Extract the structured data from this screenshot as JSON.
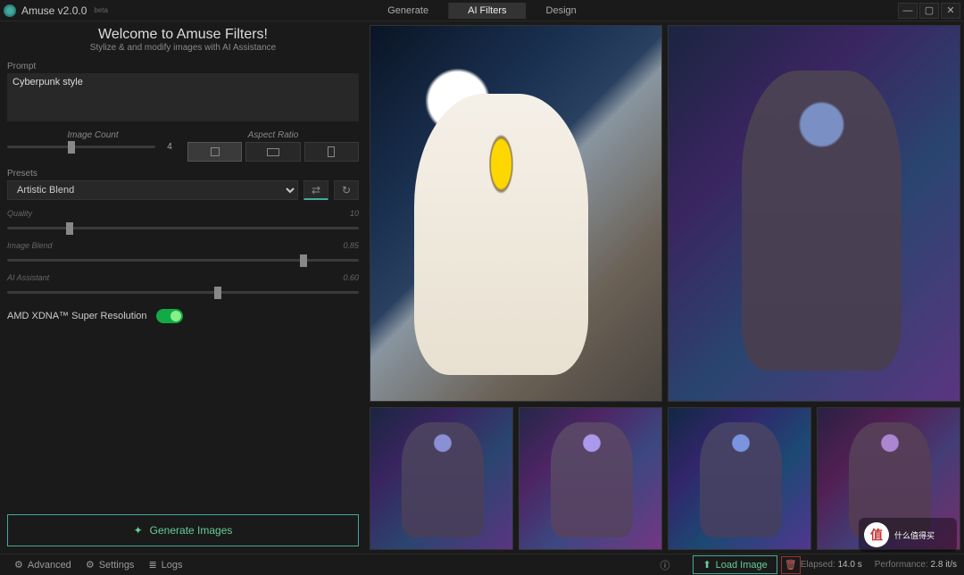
{
  "title": {
    "app": "Amuse v2.0.0",
    "beta": "beta"
  },
  "tabs": {
    "generate": "Generate",
    "filters": "AI Filters",
    "design": "Design"
  },
  "welcome": {
    "headline": "Welcome to Amuse Filters!",
    "sub": "Stylize & and modify images with AI Assistance"
  },
  "prompt": {
    "label": "Prompt",
    "value": "Cyberpunk style"
  },
  "sliders": {
    "image_count": {
      "label": "Image Count",
      "value": "4"
    },
    "aspect_ratio_label": "Aspect Ratio",
    "quality": {
      "label": "Quality",
      "value": "10"
    },
    "image_blend": {
      "label": "Image Blend",
      "value": "0.85"
    },
    "ai_assistant": {
      "label": "AI Assistant",
      "value": "0.60"
    }
  },
  "presets": {
    "label": "Presets",
    "selected": "Artistic Blend"
  },
  "super_res": "AMD XDNA™ Super Resolution",
  "buttons": {
    "generate": "Generate Images",
    "load": "Load Image"
  },
  "footer": {
    "advanced": "Advanced",
    "settings": "Settings",
    "logs": "Logs",
    "elapsed_label": "Elapsed:",
    "elapsed_value": "14.0 s",
    "perf_label": "Performance:",
    "perf_value": "2.8 it/s"
  },
  "watermark": "什么值得买"
}
